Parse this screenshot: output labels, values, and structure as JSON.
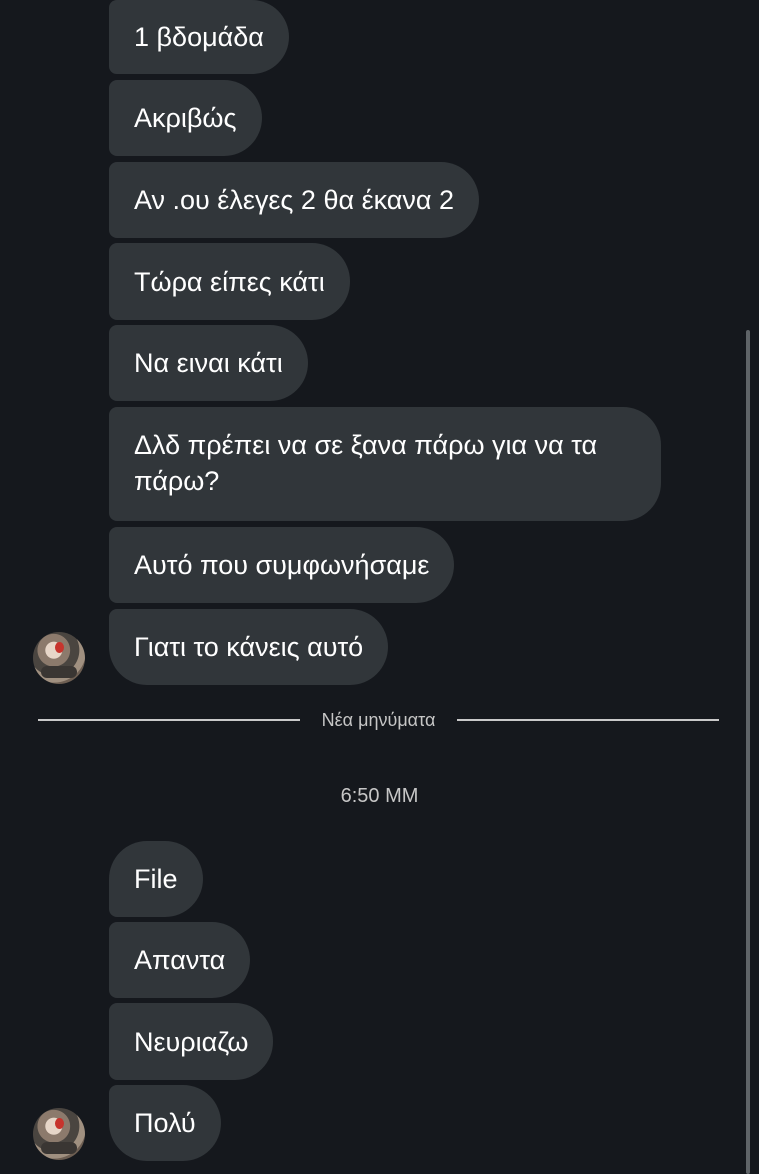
{
  "messages_before": [
    "1 βδομάδα",
    "Ακριβώς",
    "Αν .ου έλεγες 2 θα έκανα 2",
    "Τώρα είπες κάτι",
    "Να ειναι κάτι",
    "Δλδ πρέπει να σε ξανα πάρω για να τα πάρω?",
    "Αυτό που συμφωνήσαμε",
    "Γιατι το κάνεις αυτό"
  ],
  "divider_label": "Νέα μηνύματα",
  "timestamp": "6:50 ΜΜ",
  "messages_after": [
    "File",
    "Απαντα",
    "Νευριαζω",
    "Πολύ"
  ],
  "colors": {
    "background": "#15181d",
    "bubble": "#31363a",
    "text": "#ffffff",
    "muted_text": "#c6c6c6"
  },
  "icons": {
    "sender_avatar": "profile-photo"
  }
}
